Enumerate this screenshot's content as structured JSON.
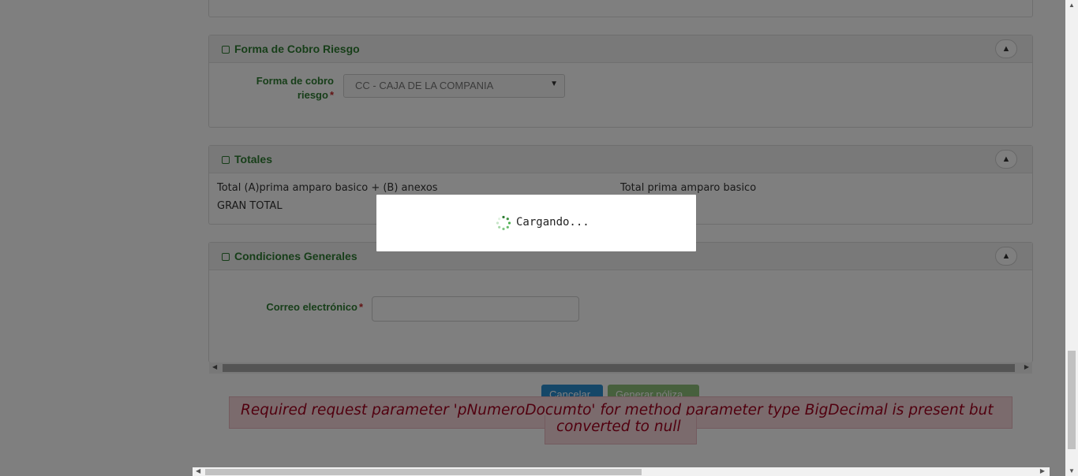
{
  "sections": {
    "cobro": {
      "title": "Forma de Cobro Riesgo",
      "field_label_line1": "Forma de cobro",
      "field_label_line2": "riesgo",
      "required_mark": "*",
      "select_value": "CC - CAJA DE LA COMPANIA"
    },
    "totales": {
      "title": "Totales",
      "total_ab_label": "Total (A)prima amparo basico + (B) anexos",
      "total_prima_label": "Total prima amparo basico",
      "gran_total_label": "GRAN TOTAL"
    },
    "condiciones": {
      "title": "Condiciones Generales",
      "email_label": "Correo electrónico",
      "required_mark": "*",
      "email_value": ""
    }
  },
  "actions": {
    "cancel_label": "Cancelar",
    "generate_label": "Generar póliza"
  },
  "error": {
    "line1": "Required request parameter 'pNumeroDocumto' for method parameter type BigDecimal is present but",
    "line2": "converted to null"
  },
  "loading": {
    "text": "Cargando..."
  },
  "icons": {
    "section": "edit-icon",
    "collapse": "chevron-up-icon",
    "spinner": "spinner-icon"
  },
  "colors": {
    "accent_green": "#2e7d32",
    "error_text": "#a3001f",
    "cancel_button": "#2a8fd1",
    "generate_button": "#8ec07a"
  }
}
